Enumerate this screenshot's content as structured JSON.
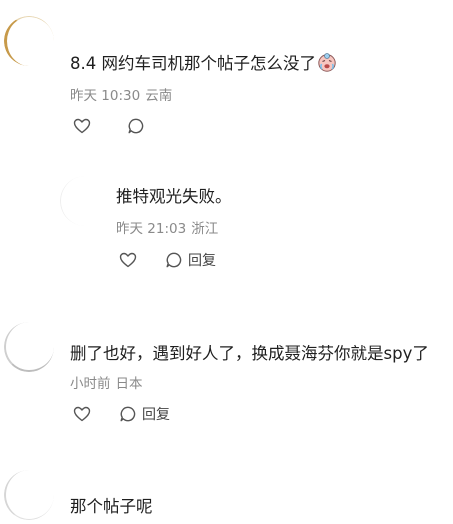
{
  "comments": [
    {
      "text": "8.4 网约车司机那个帖子怎么没了",
      "emoji": "crying-face-emoji",
      "time": "昨天 10:30",
      "location": "云南",
      "reply_label": ""
    },
    {
      "text": "推特观光失败。",
      "time": "昨天 21:03",
      "location": "浙江",
      "reply_label": "回复"
    },
    {
      "text": "删了也好，遇到好人了，换成聂海芬你就是spy了",
      "time": "小时前",
      "location": "日本",
      "reply_label": "回复"
    },
    {
      "text": "那个帖子呢"
    }
  ],
  "colors": {
    "text": "#1f1f1f",
    "meta": "#8a8a8a",
    "icon": "#555555"
  }
}
